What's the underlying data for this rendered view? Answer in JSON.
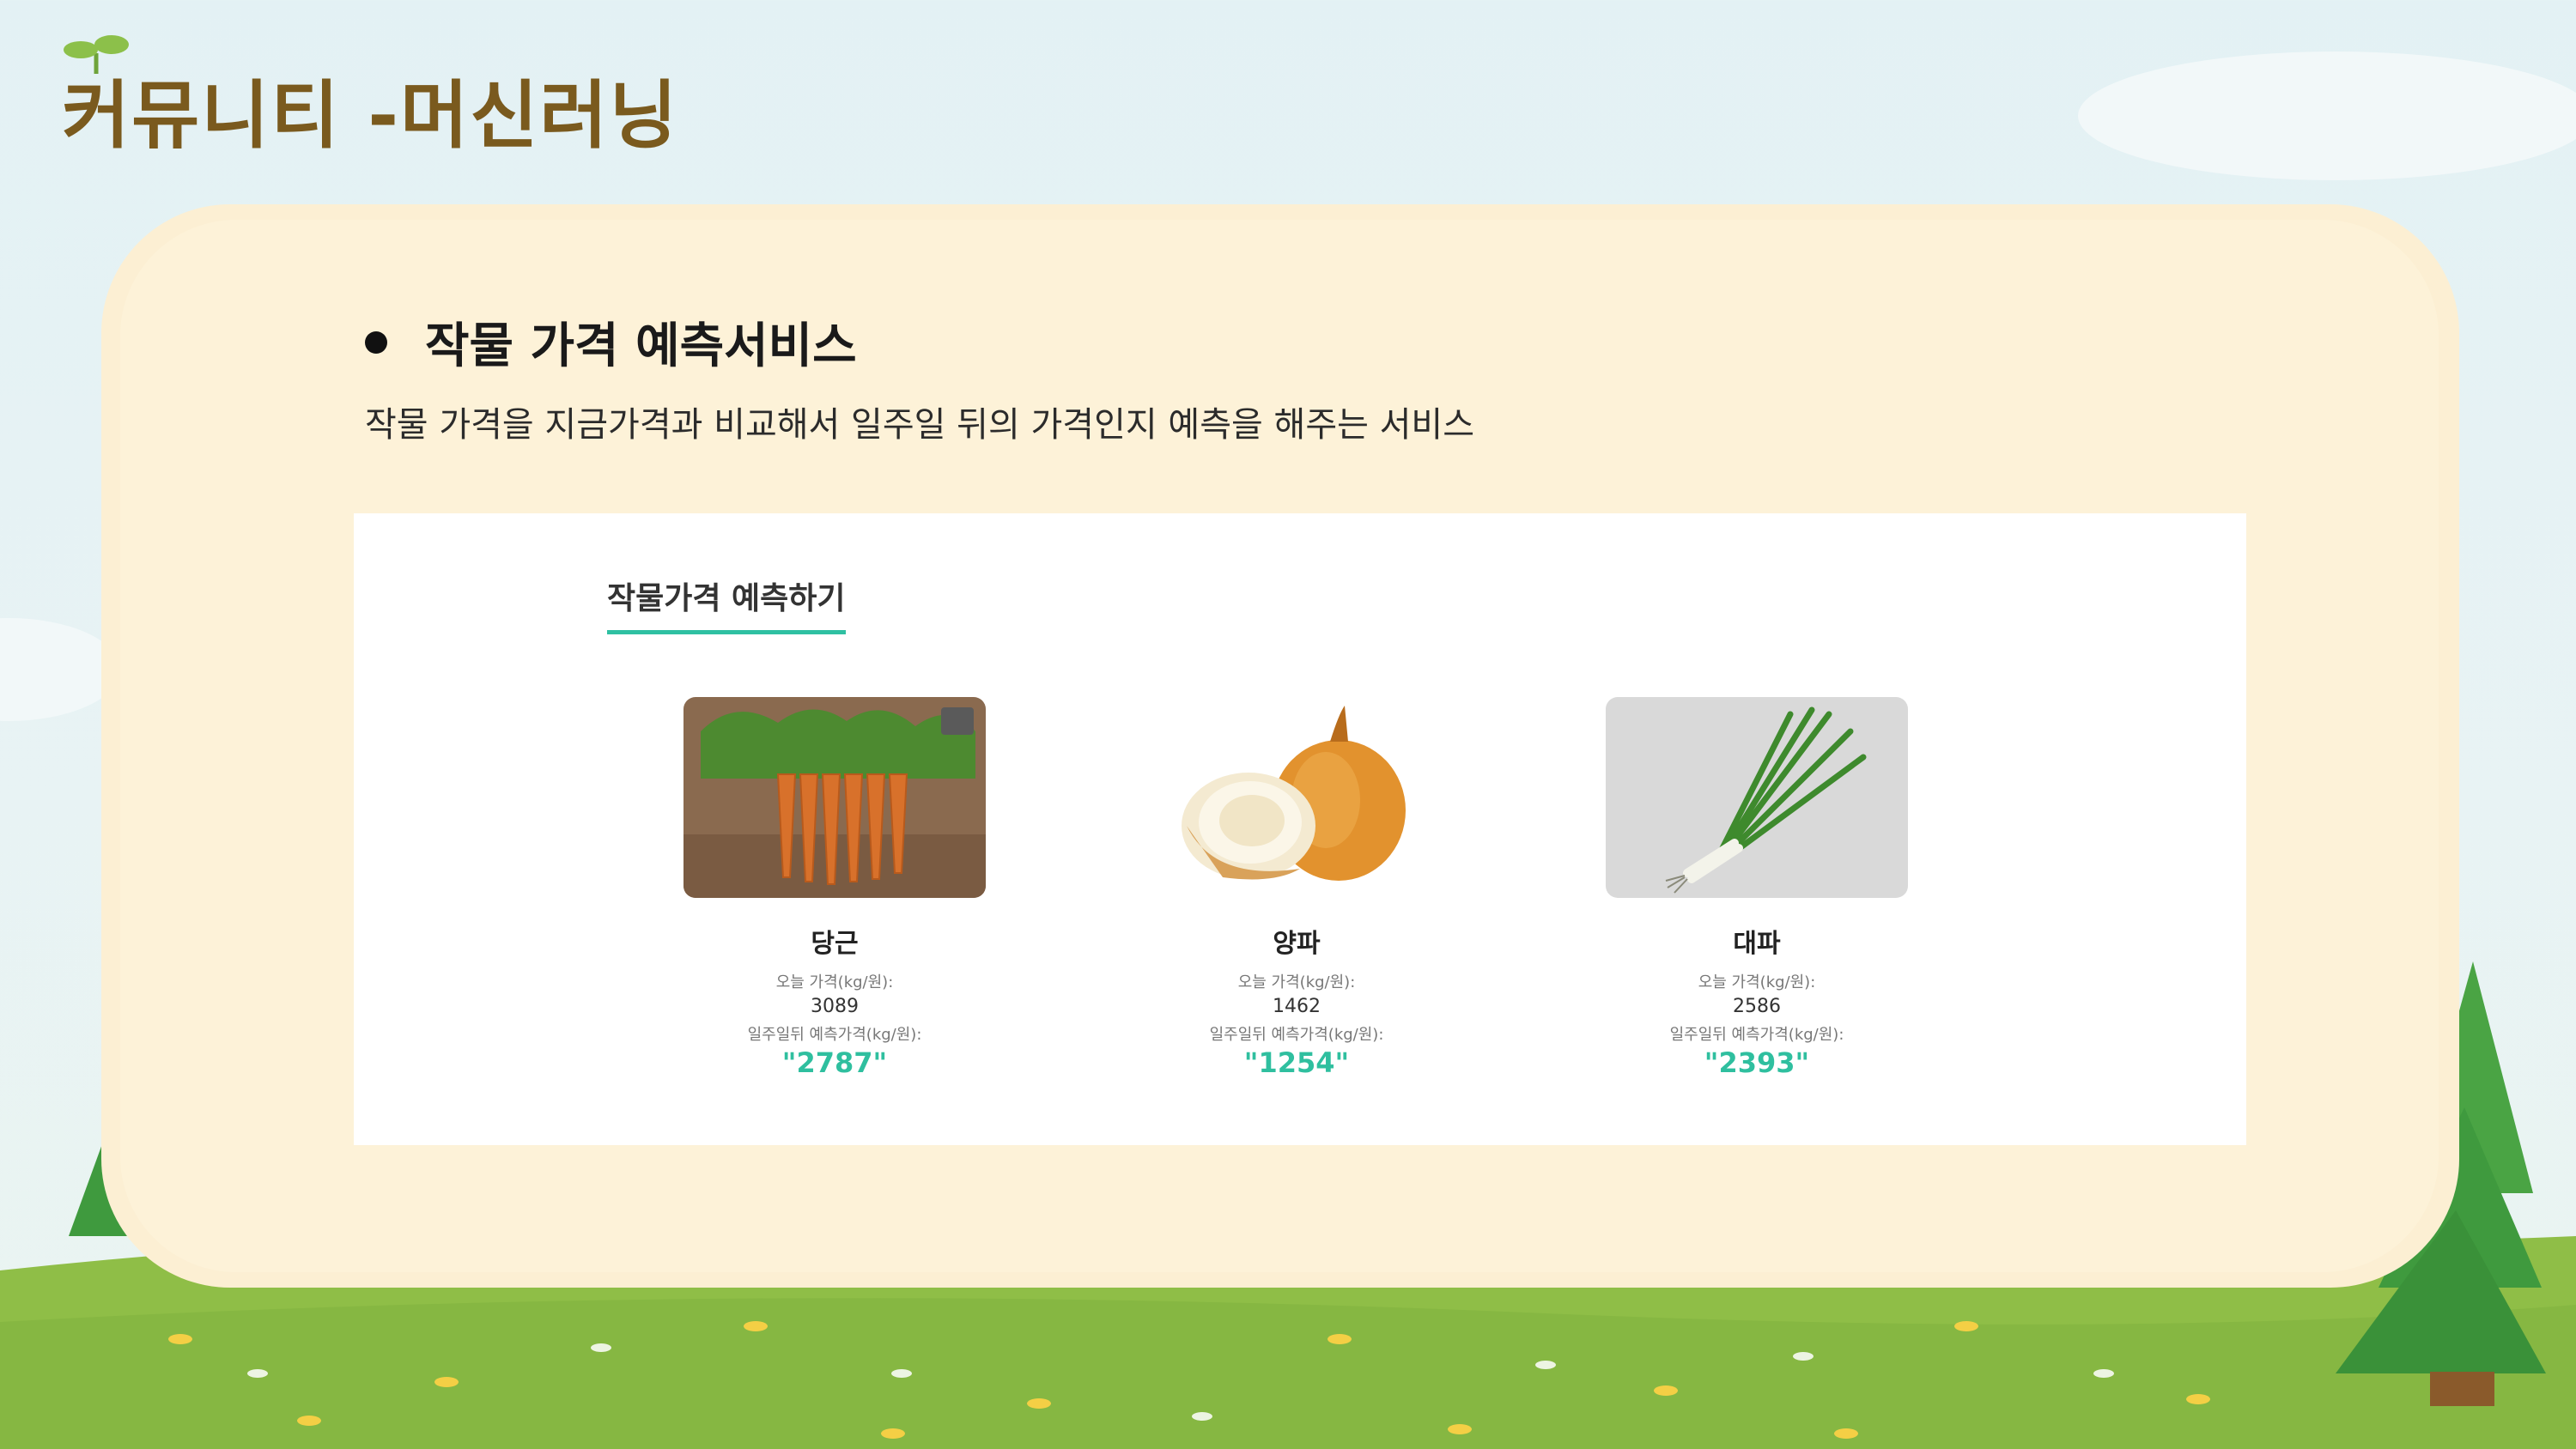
{
  "page": {
    "title": "커뮤니티 -머신러닝"
  },
  "section": {
    "heading": "작물 가격 예측서비스",
    "description": "작물 가격을 지금가격과 비교해서 일주일 뒤의 가격인지 예측을 해주는 서비스"
  },
  "panel": {
    "tab_label": "작물가격 예측하기",
    "crops": [
      {
        "name": "당근",
        "today_label": "오늘 가격(kg/원):",
        "today_value": "3089",
        "predict_label": "일주일뒤 예측가격(kg/원):",
        "predict_value": "\"2787\"",
        "icon": "carrot-image"
      },
      {
        "name": "양파",
        "today_label": "오늘 가격(kg/원):",
        "today_value": "1462",
        "predict_label": "일주일뒤 예측가격(kg/원):",
        "predict_value": "\"1254\"",
        "icon": "onion-image"
      },
      {
        "name": "대파",
        "today_label": "오늘 가격(kg/원):",
        "today_value": "2586",
        "predict_label": "일주일뒤 예측가격(kg/원):",
        "predict_value": "\"2393\"",
        "icon": "green-onion-image"
      }
    ]
  },
  "colors": {
    "title": "#7a5a1e",
    "card": "#fdf2d8",
    "accent": "#2fbf9f",
    "grass": "#8fbe47",
    "tree": "#3f9a3e"
  }
}
